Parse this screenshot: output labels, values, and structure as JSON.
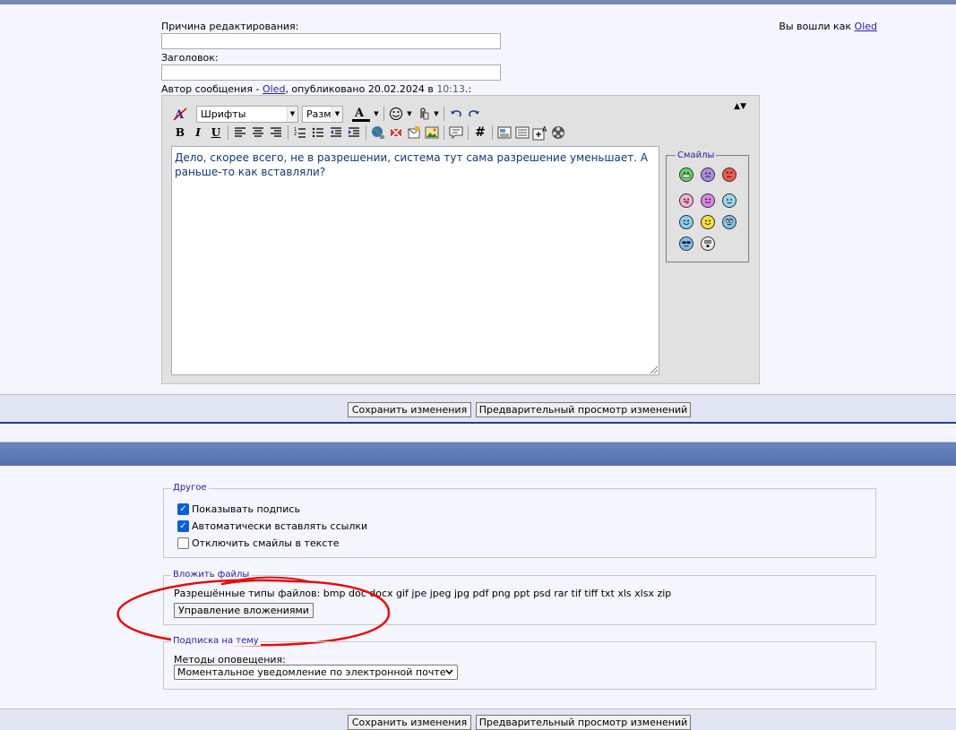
{
  "header": {
    "logged_in_prefix": "Вы вошли как ",
    "username": "Oled"
  },
  "form": {
    "reason_label": "Причина редактирования:",
    "reason_value": "",
    "title_label": "Заголовок:",
    "title_value": "",
    "author_prefix": "Автор сообщения - ",
    "author_name": "Oled",
    "published_text": ", опубликовано 20.02.2024 в ",
    "published_time": "10:13",
    "published_suffix": ".:"
  },
  "editor": {
    "font_combo": "Шрифты",
    "size_combo": "Размер",
    "collapse_symbol": "▲▼",
    "text": "Дело, скорее всего, не в разрешении, система тут сама разрешение уменьшает. А раньше-то как вставляли?",
    "smilies_legend": "Смайлы",
    "icons": {
      "bold": "B",
      "italic": "I",
      "underline": "U",
      "hash": "#"
    }
  },
  "buttons": {
    "save": "Сохранить изменения",
    "preview": "Предварительный просмотр изменений"
  },
  "other": {
    "legend": "Другое",
    "show_signature": "Показывать подпись",
    "auto_links": "Автоматически вставлять ссылки",
    "disable_smilies": "Отключить смайлы в тексте"
  },
  "attachments": {
    "legend": "Вложить файлы",
    "allowed_types": "Разрешённые типы файлов: bmp doc docx gif jpe jpeg jpg pdf png ppt psd rar tif tiff txt xls xlsx zip",
    "manage_button": "Управление вложениями"
  },
  "subscription": {
    "legend": "Подписка на тему",
    "methods_label": "Методы оповещения:",
    "method_selected": "Моментальное уведомление по электронной почте"
  },
  "colors": {
    "link": "#22229c",
    "header_bar": "#5570ac",
    "annotation": "#e01010",
    "checkbox": "#0a5fd6"
  }
}
